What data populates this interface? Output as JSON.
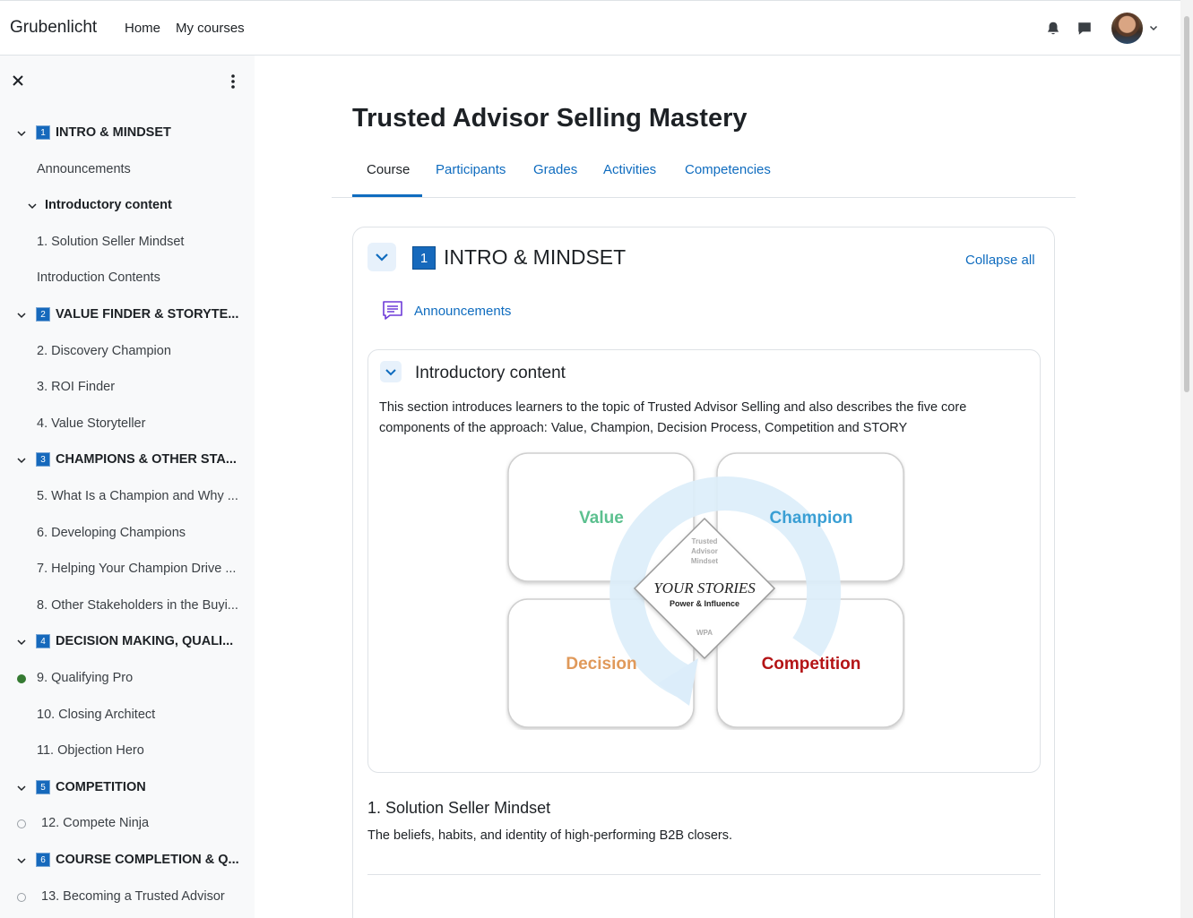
{
  "navbar": {
    "brand": "Grubenlicht",
    "links": [
      "Home",
      "My courses"
    ],
    "icons": [
      "bell-icon",
      "chat-icon",
      "avatar",
      "chevron-down-icon"
    ]
  },
  "course_index": {
    "items": [
      {
        "kind": "section",
        "num": "1",
        "label": "INTRO & MINDSET"
      },
      {
        "kind": "item",
        "label": "Announcements"
      },
      {
        "kind": "subsection",
        "label": "Introductory content"
      },
      {
        "kind": "item",
        "label": "1. Solution Seller Mindset"
      },
      {
        "kind": "item",
        "label": "Introduction Contents"
      },
      {
        "kind": "section",
        "num": "2",
        "label": "VALUE FINDER & STORYTE..."
      },
      {
        "kind": "item",
        "label": "2. Discovery Champion"
      },
      {
        "kind": "item",
        "label": "3. ROI Finder"
      },
      {
        "kind": "item",
        "label": "4. Value Storyteller"
      },
      {
        "kind": "section",
        "num": "3",
        "label": "CHAMPIONS & OTHER STA..."
      },
      {
        "kind": "item",
        "label": "5. What Is a Champion and Why ..."
      },
      {
        "kind": "item",
        "label": "6. Developing Champions"
      },
      {
        "kind": "item",
        "label": "7. Helping Your Champion Drive ..."
      },
      {
        "kind": "item",
        "label": "8. Other Stakeholders in the Buyi..."
      },
      {
        "kind": "section",
        "num": "4",
        "label": "DECISION MAKING, QUALI..."
      },
      {
        "kind": "item",
        "label": "9. Qualifying Pro",
        "status": "done"
      },
      {
        "kind": "item",
        "label": "10. Closing Architect"
      },
      {
        "kind": "item",
        "label": "11. Objection Hero"
      },
      {
        "kind": "section",
        "num": "5",
        "label": "COMPETITION"
      },
      {
        "kind": "item",
        "label": "12. Compete Ninja",
        "status": "open"
      },
      {
        "kind": "section",
        "num": "6",
        "label": "COURSE COMPLETION & Q..."
      },
      {
        "kind": "item",
        "label": "13. Becoming a Trusted Advisor",
        "status": "open"
      }
    ]
  },
  "main": {
    "title": "Trusted Advisor Selling Mastery",
    "tabs": [
      "Course",
      "Participants",
      "Grades",
      "Activities",
      "Competencies"
    ],
    "active_tab": "Course",
    "section": {
      "num": "1",
      "title": "INTRO & MINDSET",
      "collapse_label": "Collapse all",
      "forum_link": "Announcements",
      "subsection": {
        "title": "Introductory content",
        "description": "This section introduces learners to the topic of Trusted Advisor Selling and also describes the five core components of the approach: Value, Champion, Decision Process, Competition and STORY",
        "diagram": {
          "quadrants": [
            "Value",
            "Champion",
            "Decision",
            "Competition"
          ],
          "center_small": [
            "Trusted",
            "Advisor",
            "Mindset"
          ],
          "center_title": "YOUR STORIES",
          "center_subtitle": "Power & Influence",
          "center_footer": "WPA",
          "colors": {
            "value": "#5cc08f",
            "champion": "#3a9fd4",
            "decision": "#e0995a",
            "competition": "#b41416",
            "arrow": "#dcedfa"
          }
        }
      },
      "lesson": {
        "title": "1. Solution Seller Mindset",
        "description": "The beliefs, habits, and identity of high-performing B2B closers."
      }
    }
  },
  "colors": {
    "accent": "#0f6cbf",
    "section_badge": "#1669bc",
    "complete": "#357a32"
  }
}
